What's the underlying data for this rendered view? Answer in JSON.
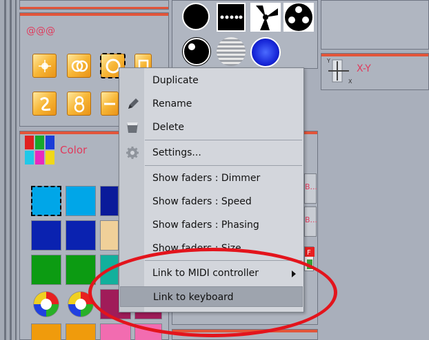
{
  "effects_panel": {
    "title": "@@@"
  },
  "color_panel": {
    "title": "Color"
  },
  "xy_panel": {
    "title": "X-Y"
  },
  "faders_panel": {
    "label1": "B...",
    "label2": "B..."
  },
  "context_menu": {
    "items": [
      {
        "label": "Duplicate",
        "icon": "none"
      },
      {
        "label": "Rename",
        "icon": "pencil-icon"
      },
      {
        "label": "Delete",
        "icon": "trash-icon"
      },
      {
        "label": "Settings...",
        "icon": "gear-icon"
      },
      {
        "label": "Show faders : Dimmer",
        "icon": "none"
      },
      {
        "label": "Show faders : Speed",
        "icon": "none"
      },
      {
        "label": "Show faders : Phasing",
        "icon": "none"
      },
      {
        "label": "Show faders : Size",
        "icon": "none"
      },
      {
        "label": "Link to MIDI controller",
        "icon": "chevron-right-icon",
        "submenu": true
      },
      {
        "label": "Link to keyboard",
        "icon": "none",
        "highlighted": true
      }
    ]
  },
  "colors": {
    "accent_red": "#e2553a",
    "title_pink": "#e03a5c",
    "highlight_ring": "#e3141c",
    "swatches": [
      [
        "#00a6e8",
        "#00a6e8",
        "#0a1a9a"
      ],
      [
        "#0a22b0",
        "#0a22b0",
        "#f0d099"
      ],
      [
        "#0c9b12",
        "#0c9b12",
        "#12b09c"
      ],
      [
        "rainbow",
        "rainbow",
        "#a01c59"
      ],
      [
        "#f09b0c",
        "#f09b0c",
        "#f26cb0"
      ]
    ]
  }
}
